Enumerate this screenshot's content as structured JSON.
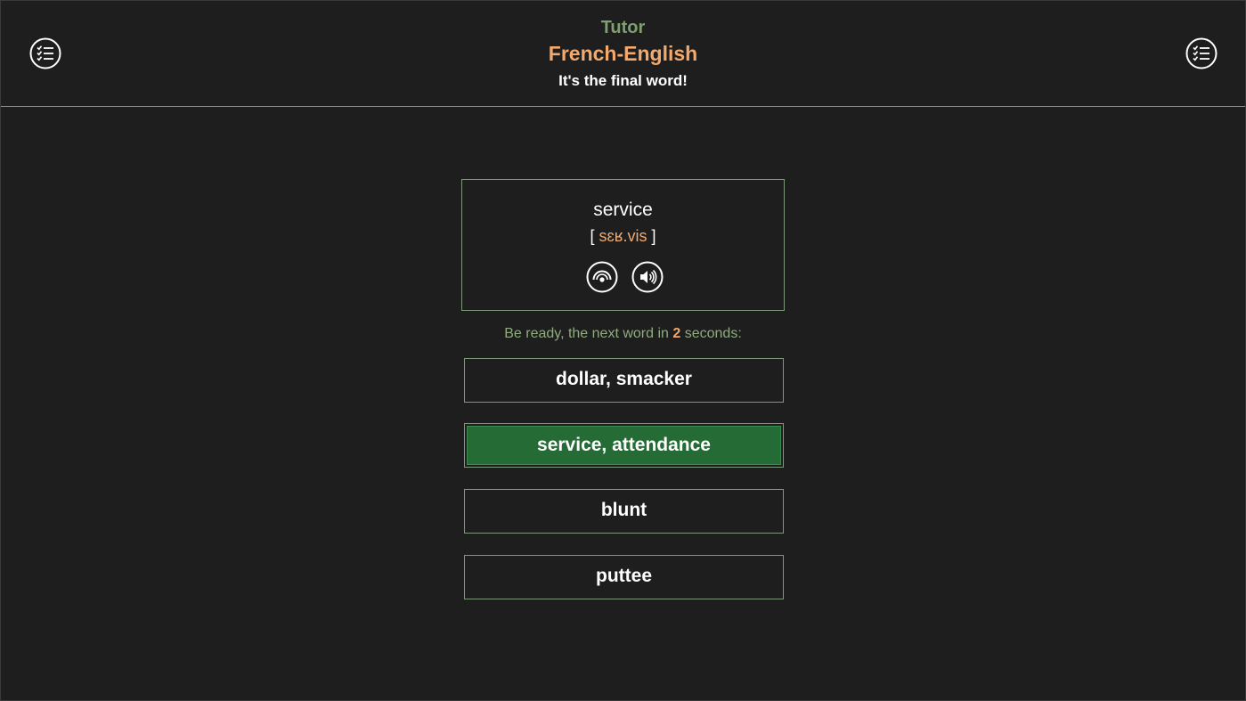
{
  "header": {
    "app_name": "Tutor",
    "course_name": "French-English",
    "status_text": "It's the final word!",
    "left_menu_icon": "checklist-icon",
    "right_menu_icon": "checklist-icon"
  },
  "card": {
    "word": "service",
    "transcription_open": "[",
    "transcription_ipa": "sɛʁ.vis",
    "transcription_close": "]",
    "reveal_icon": "eye-icon",
    "sound_icon": "speaker-icon"
  },
  "countdown": {
    "prefix": "Be ready, the next word in",
    "seconds": "2",
    "suffix": "seconds:"
  },
  "answers": [
    {
      "label": "dollar, smacker",
      "state": "default"
    },
    {
      "label": "service, attendance",
      "state": "correct"
    },
    {
      "label": "blunt",
      "state": "default"
    },
    {
      "label": "puttee",
      "state": "default"
    }
  ],
  "colors": {
    "background": "#1e1e1e",
    "accent_green": "#7e9f6f",
    "accent_orange": "#f3a96b",
    "correct_fill": "#256b35",
    "border": "#7f9a7a"
  }
}
